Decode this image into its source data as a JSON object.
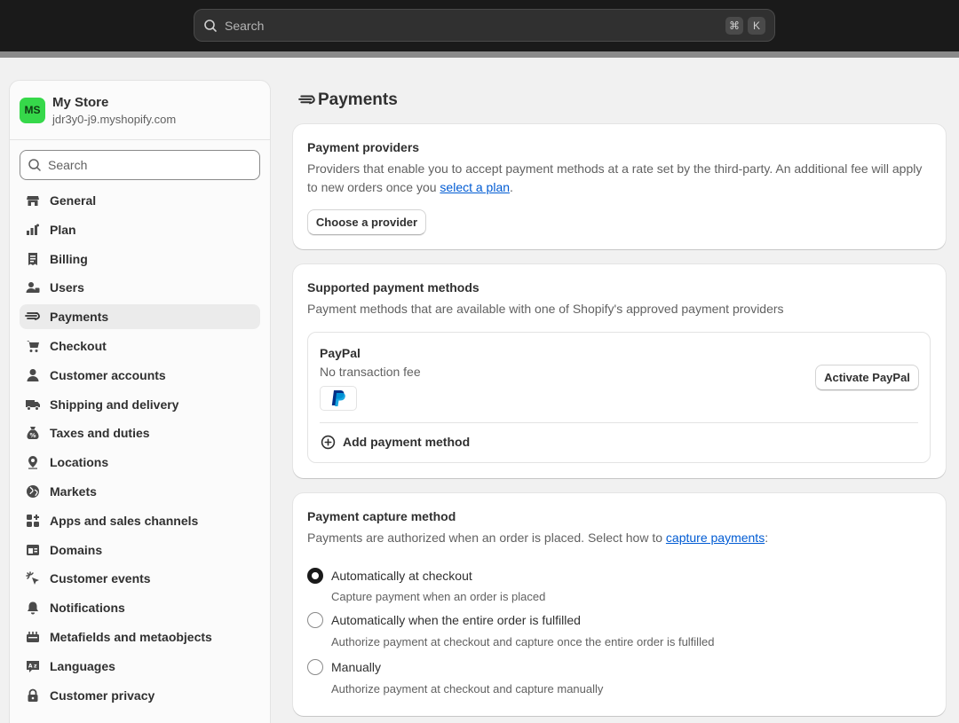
{
  "topbar": {
    "search_placeholder": "Search",
    "shortcut_keys": [
      "⌘",
      "K"
    ]
  },
  "sidebar": {
    "store": {
      "initials": "MS",
      "name": "My Store",
      "url": "jdr3y0-j9.myshopify.com",
      "avatar_color": "#36d84a"
    },
    "search_placeholder": "Search",
    "items": [
      {
        "label": "General",
        "icon": "store-icon"
      },
      {
        "label": "Plan",
        "icon": "plan-icon"
      },
      {
        "label": "Billing",
        "icon": "receipt-icon"
      },
      {
        "label": "Users",
        "icon": "users-icon"
      },
      {
        "label": "Payments",
        "icon": "payments-icon",
        "active": true
      },
      {
        "label": "Checkout",
        "icon": "cart-icon"
      },
      {
        "label": "Customer accounts",
        "icon": "person-icon"
      },
      {
        "label": "Shipping and delivery",
        "icon": "truck-icon"
      },
      {
        "label": "Taxes and duties",
        "icon": "money-bag-icon"
      },
      {
        "label": "Locations",
        "icon": "location-pin-icon"
      },
      {
        "label": "Markets",
        "icon": "globe-icon"
      },
      {
        "label": "Apps and sales channels",
        "icon": "apps-icon"
      },
      {
        "label": "Domains",
        "icon": "domain-icon"
      },
      {
        "label": "Customer events",
        "icon": "cursor-click-icon"
      },
      {
        "label": "Notifications",
        "icon": "bell-icon"
      },
      {
        "label": "Metafields and metaobjects",
        "icon": "metafields-icon"
      },
      {
        "label": "Languages",
        "icon": "language-icon"
      },
      {
        "label": "Customer privacy",
        "icon": "lock-icon"
      }
    ]
  },
  "main": {
    "title": "Payments",
    "providers": {
      "heading": "Payment providers",
      "desc_before_link": "Providers that enable you to accept payment methods at a rate set by the third-party. An additional fee will apply to new orders once you ",
      "link": "select a plan",
      "desc_after_link": ".",
      "button": "Choose a provider"
    },
    "supported": {
      "heading": "Supported payment methods",
      "desc": "Payment methods that are available with one of Shopify's approved payment providers",
      "method": {
        "name": "PayPal",
        "fee": "No transaction fee",
        "button": "Activate PayPal",
        "logo_icon": "paypal-logo-icon"
      },
      "add_label": "Add payment method"
    },
    "capture": {
      "heading": "Payment capture method",
      "desc_before_link": "Payments are authorized when an order is placed. Select how to ",
      "link": "capture payments",
      "desc_after_link": ":",
      "options": [
        {
          "label": "Automatically at checkout",
          "help": "Capture payment when an order is placed",
          "selected": true
        },
        {
          "label": "Automatically when the entire order is fulfilled",
          "help": "Authorize payment at checkout and capture once the entire order is fulfilled",
          "selected": false
        },
        {
          "label": "Manually",
          "help": "Authorize payment at checkout and capture manually",
          "selected": false
        }
      ]
    }
  },
  "colors": {
    "link": "#005bd3",
    "topbar": "#1a1a1a",
    "page_bg": "#f1f1f1",
    "paypal_dark": "#003087",
    "paypal_light": "#009cde"
  }
}
